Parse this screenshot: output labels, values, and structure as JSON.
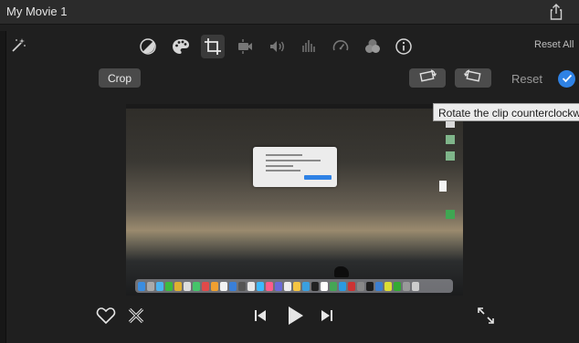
{
  "window": {
    "title": "My Movie 1"
  },
  "toolbar": {
    "icons": [
      "color-balance-icon",
      "color-correction-icon",
      "crop-icon",
      "stabilization-icon",
      "volume-icon",
      "noise-reduction-icon",
      "speed-icon",
      "clip-filter-icon",
      "info-icon"
    ],
    "active": "crop-icon",
    "reset_all_label": "Reset All"
  },
  "crop_controls": {
    "crop_label": "Crop",
    "reset_label": "Reset",
    "tooltip": "Rotate the clip counterclockwise"
  },
  "colors": {
    "accent": "#2f82e5",
    "background": "#1f1f1f"
  }
}
